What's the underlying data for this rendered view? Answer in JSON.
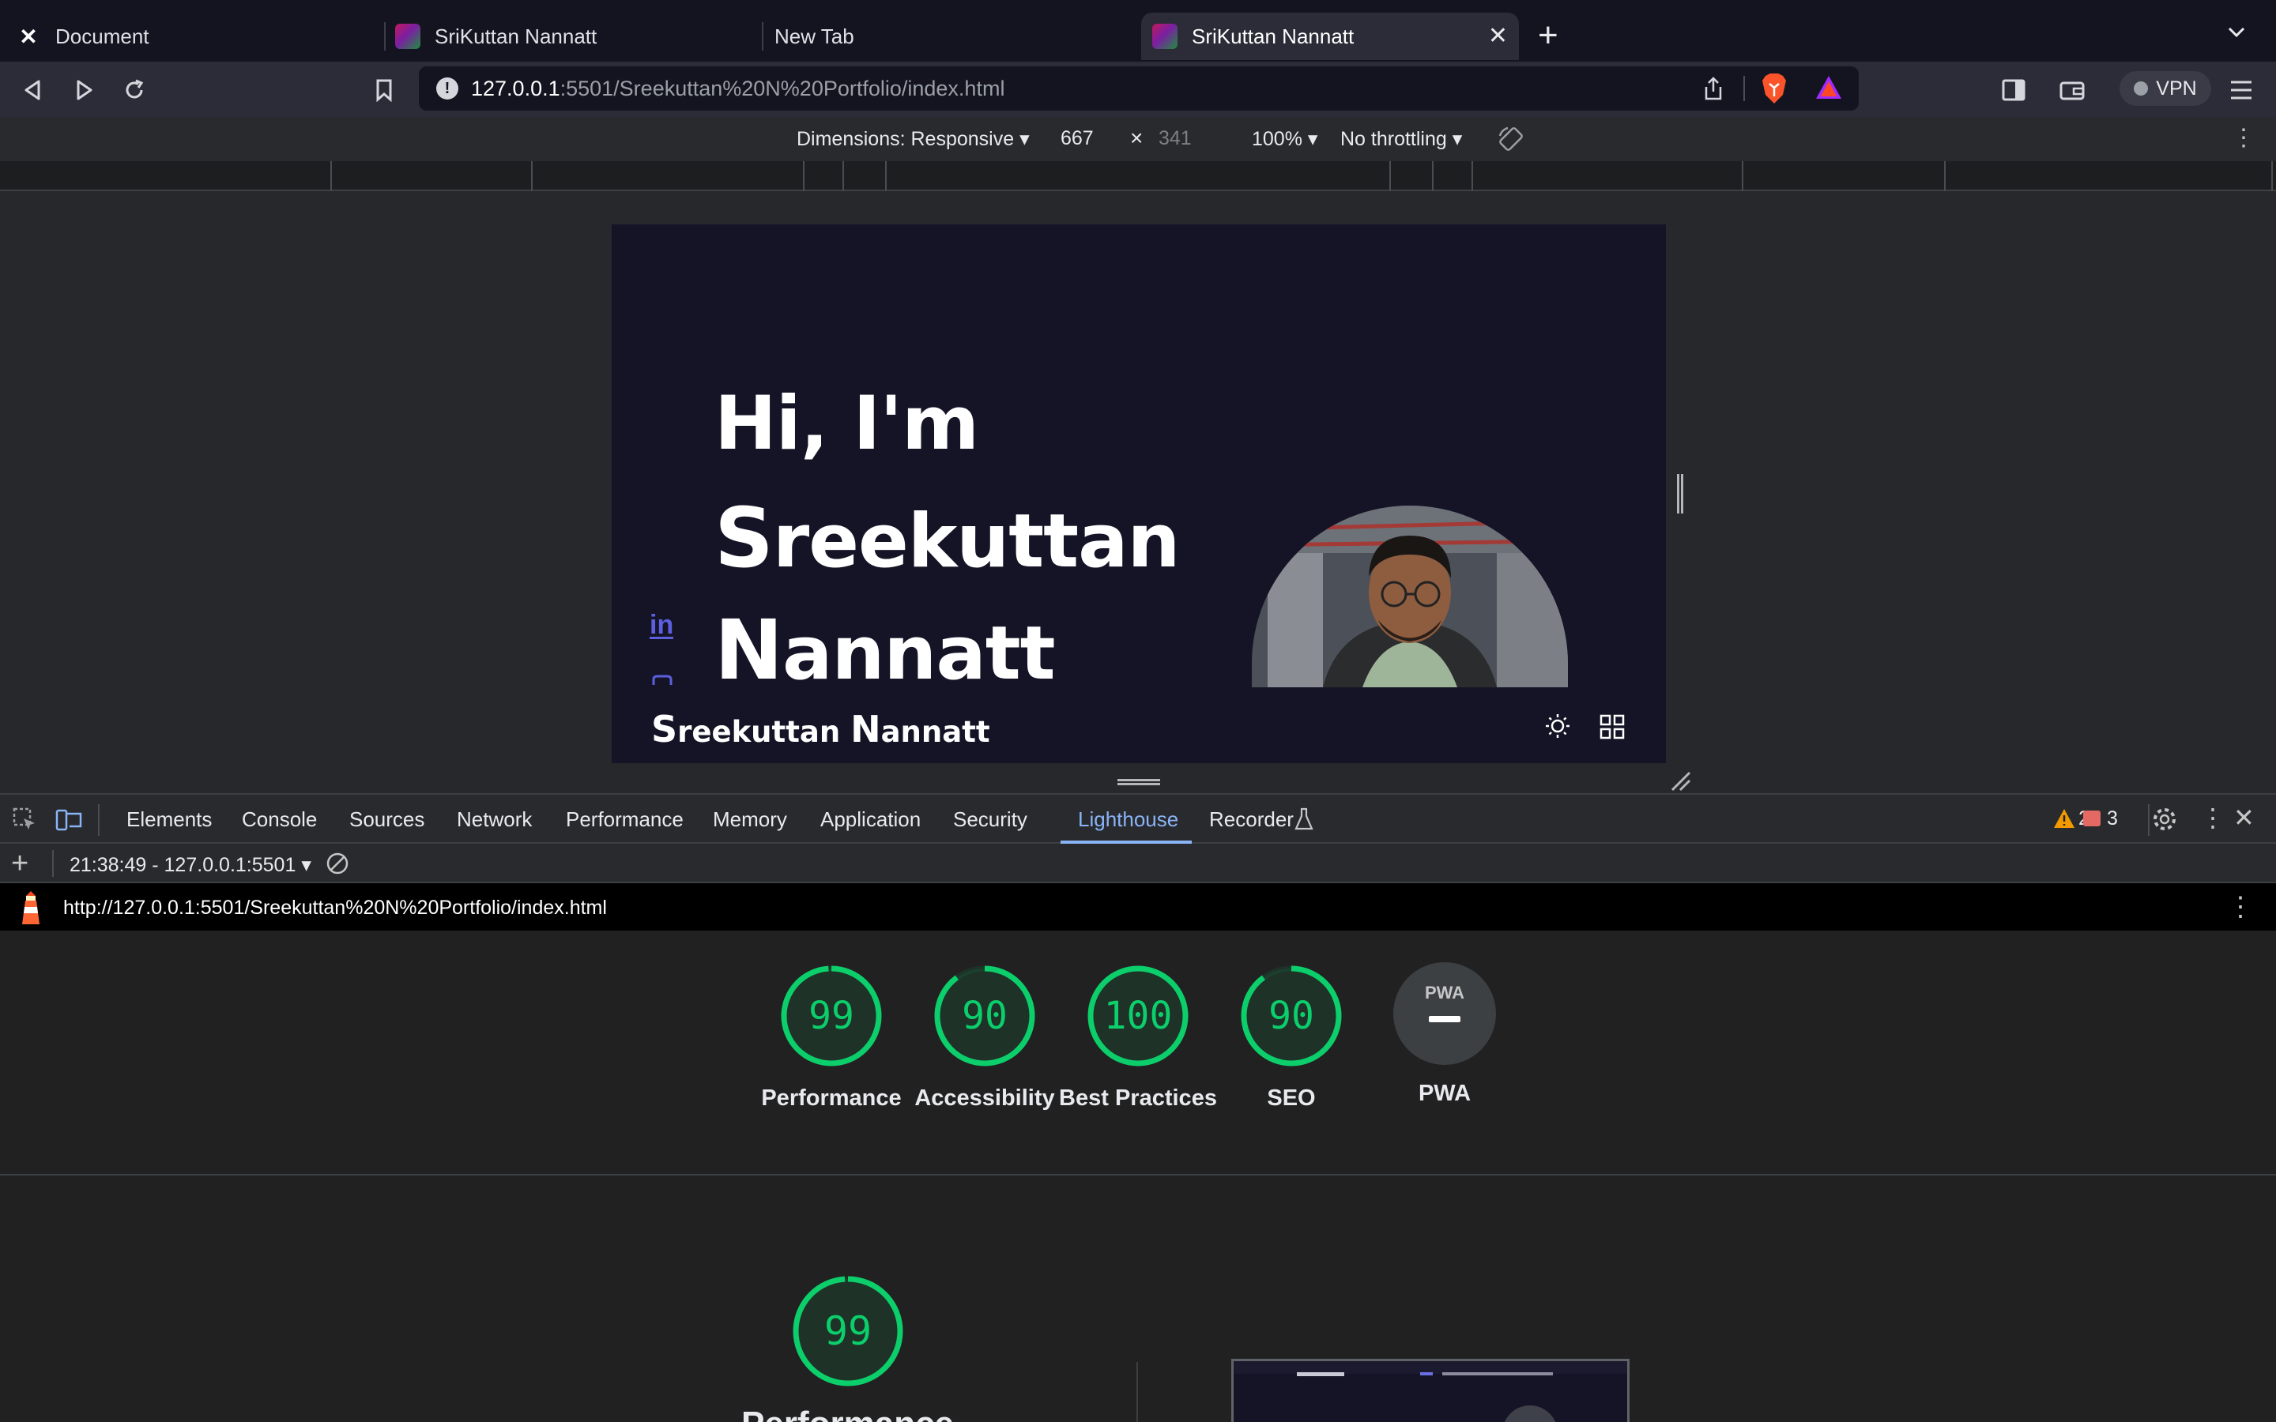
{
  "browser": {
    "tabs": [
      {
        "title": "Document"
      },
      {
        "title": "SriKuttan Nannatt"
      },
      {
        "title": "New Tab"
      },
      {
        "title": "SriKuttan Nannatt"
      }
    ],
    "url_host": "127.0.0.1",
    "url_path": ":5501/Sreekuttan%20N%20Portfolio/index.html",
    "vpn_label": "VPN"
  },
  "device_toolbar": {
    "dimensions_label": "Dimensions: Responsive",
    "width": "667",
    "times": "×",
    "height": "341",
    "zoom": "100%",
    "throttling": "No throttling"
  },
  "site": {
    "hero_line1": "Hi, I'm",
    "hero_line2_cap": "S",
    "hero_line2_rest": "reekuttan",
    "hero_line3_cap": "N",
    "hero_line3_rest": "annatt",
    "brand_cap1": "S",
    "brand_rest1": "reekuttan ",
    "brand_cap2": "N",
    "brand_rest2": "annatt",
    "linkedin_text": "in"
  },
  "devtools": {
    "tabs": [
      "Elements",
      "Console",
      "Sources",
      "Network",
      "Performance",
      "Memory",
      "Application",
      "Security",
      "Lighthouse",
      "Recorder"
    ],
    "active_tab": "Lighthouse",
    "warnings": "26",
    "errors": "3",
    "report_selector": "21:38:49 - 127.0.0.1:5501",
    "report_url": "http://127.0.0.1:5501/Sreekuttan%20N%20Portfolio/index.html"
  },
  "lighthouse": {
    "scores": [
      {
        "score": 99,
        "label": "Performance"
      },
      {
        "score": 90,
        "label": "Accessibility"
      },
      {
        "score": 100,
        "label": "Best Practices"
      },
      {
        "score": 90,
        "label": "SEO"
      }
    ],
    "pwa_label": "PWA",
    "pwa_badge": "PWA",
    "big_score": 99,
    "big_label": "Performance",
    "score_color": "#0cce6b"
  }
}
